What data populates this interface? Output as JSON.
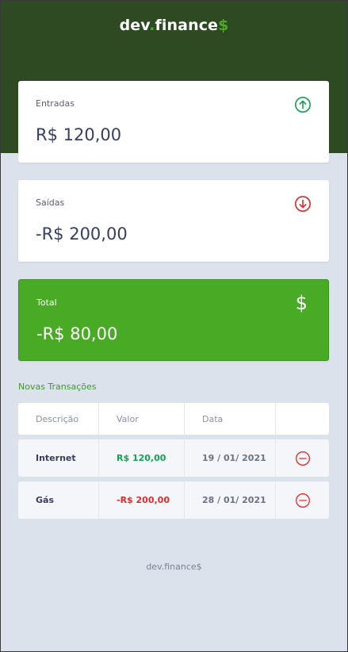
{
  "header": {
    "logo_part1": "dev",
    "logo_dot": ".",
    "logo_part2": "finance",
    "logo_dollar": "$"
  },
  "cards": {
    "income": {
      "label": "Entradas",
      "amount": "R$ 120,00",
      "icon": "arrow-up-circle-icon"
    },
    "expense": {
      "label": "Saídas",
      "amount": "-R$ 200,00",
      "icon": "arrow-down-circle-icon"
    },
    "total": {
      "label": "Total",
      "amount": "-R$ 80,00",
      "icon": "dollar-icon",
      "icon_glyph": "$"
    }
  },
  "transactions": {
    "new_label": "Novas Transações",
    "columns": [
      "Descrição",
      "Valor",
      "Data",
      ""
    ],
    "rows": [
      {
        "description": "Internet",
        "amount": "R$ 120,00",
        "date": "19 / 01/ 2021",
        "type": "income"
      },
      {
        "description": "Gás",
        "amount": "-R$ 200,00",
        "date": "28 / 01/ 2021",
        "type": "expense"
      }
    ]
  },
  "footer": {
    "text": "dev.finance$"
  },
  "colors": {
    "header_bg": "#2d4a22",
    "brand_green": "#49aa26",
    "income_green": "#12a454",
    "expense_red": "#e92929",
    "page_bg": "#dce2ec"
  }
}
